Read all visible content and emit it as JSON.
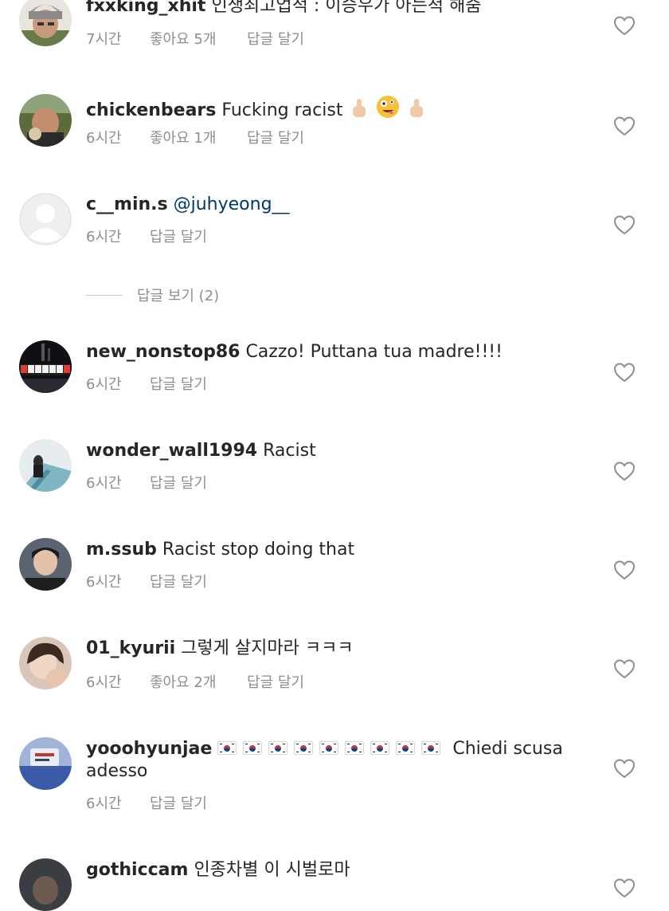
{
  "comments": [
    {
      "username": "fxxking_xhit",
      "text": "인생최고업적 : 이승우가 아는척 해줌",
      "time": "7시간",
      "likes": "좋아요 5개",
      "reply": "답글 달기",
      "avatar": "avatar-beanie-person"
    },
    {
      "username": "chickenbears",
      "text": "Fucking racist",
      "emojis": [
        "middle-finger-emoji",
        "zany-face-emoji",
        "middle-finger-emoji"
      ],
      "time": "6시간",
      "likes": "좋아요 1개",
      "reply": "답글 달기",
      "avatar": "avatar-photo"
    },
    {
      "username": "c__min.s",
      "mention": "@juhyeong__",
      "time": "6시간",
      "reply": "답글 달기",
      "avatar": "default-avatar-icon"
    },
    {
      "username": "new_nonstop86",
      "text": "Cazzo!  Puttana tua madre!!!!",
      "time": "6시간",
      "reply": "답글 달기",
      "avatar": "avatar-toronto-sign"
    },
    {
      "username": "wonder_wall1994",
      "text": "Racist",
      "time": "6시간",
      "reply": "답글 달기",
      "avatar": "avatar-stairs-photo"
    },
    {
      "username": "m.ssub",
      "text": "Racist stop doing that",
      "time": "6시간",
      "reply": "답글 달기",
      "avatar": "avatar-person-photo"
    },
    {
      "username": "01_kyurii",
      "text": "그렇게 살지마라 ㅋㅋㅋ",
      "time": "6시간",
      "likes": "좋아요 2개",
      "reply": "답글 달기",
      "avatar": "avatar-person-photo"
    },
    {
      "username": "yooohyunjae",
      "flags": [
        "south-korea-flag-emoji",
        "south-korea-flag-emoji",
        "south-korea-flag-emoji",
        "south-korea-flag-emoji",
        "south-korea-flag-emoji",
        "south-korea-flag-emoji",
        "south-korea-flag-emoji",
        "south-korea-flag-emoji",
        "south-korea-flag-emoji"
      ],
      "text": "Chiedi scusa adesso",
      "time": "6시간",
      "reply": "답글 달기",
      "avatar": "avatar-blue-photo"
    },
    {
      "username": "gothiccam",
      "text": "인종차별 이 시벌로마",
      "avatar": "avatar-dark-photo"
    }
  ],
  "view_replies": "답글 보기 (2)",
  "icons": {
    "like": "heart-outline-icon"
  },
  "colors": {
    "text": "#262626",
    "secondary": "#8e8e8e",
    "mention": "#00376b",
    "divider": "#c7c7c7"
  }
}
